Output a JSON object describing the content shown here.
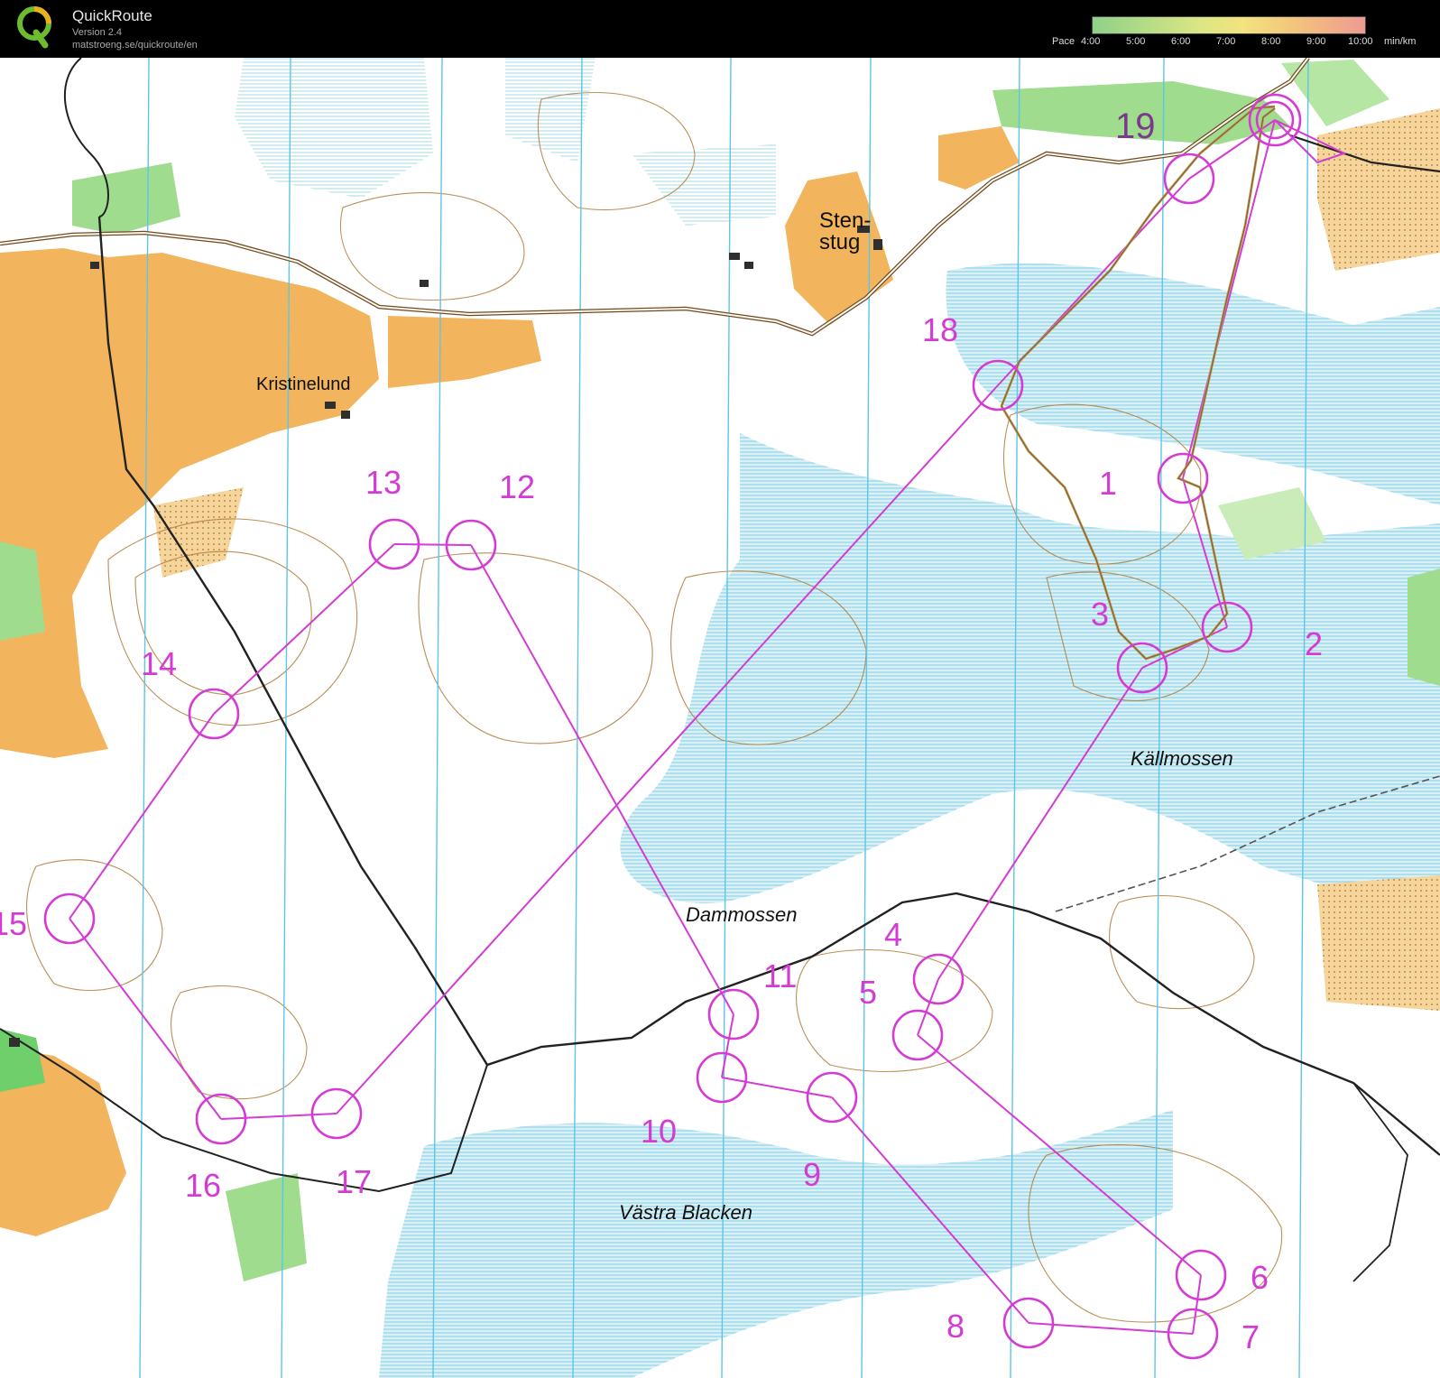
{
  "app": {
    "name": "QuickRoute",
    "version": "Version 2.4",
    "url": "matstroeng.se/quickroute/en"
  },
  "pace_legend": {
    "label": "Pace",
    "ticks": [
      "4:00",
      "5:00",
      "6:00",
      "7:00",
      "8:00",
      "9:00",
      "10:00"
    ],
    "unit": "min/km"
  },
  "map": {
    "place_names": {
      "stenstug": [
        "Sten-",
        "stug"
      ],
      "kristinelund": "Kristinelund",
      "kallmossen": "Källmossen",
      "dammossen": "Dammossen",
      "vastra_blacken": "Västra Blacken"
    },
    "controls": [
      "1",
      "2",
      "3",
      "4",
      "5",
      "6",
      "7",
      "8",
      "9",
      "10",
      "11",
      "12",
      "13",
      "14",
      "15",
      "16",
      "17",
      "18",
      "19"
    ],
    "colors": {
      "course": "#d43bd4",
      "route": "#b4a23c",
      "water": "#d6eef6",
      "field": "#f2b45c",
      "green": "#9fdc8e"
    }
  }
}
